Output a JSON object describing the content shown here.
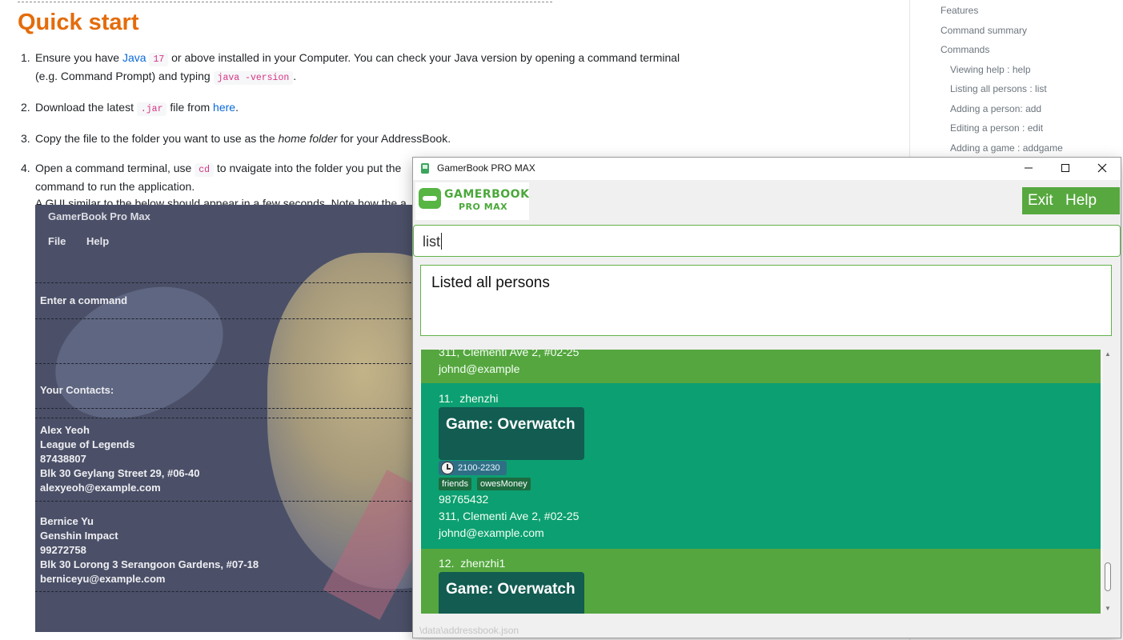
{
  "doc": {
    "title": "Quick start",
    "step1": {
      "num": "1.",
      "t1": "Ensure you have ",
      "java_link": "Java",
      "java_ver": "17",
      "t2": " or above installed in your Computer. You can check your Java version by opening a command terminal",
      "t3": "(e.g. Command Prompt) and typing ",
      "code": "java -version",
      "t4": "."
    },
    "step2": {
      "num": "2.",
      "t1": "Download the latest ",
      "code": ".jar",
      "t2": " file from ",
      "link": "here",
      "t3": "."
    },
    "step3": {
      "num": "3.",
      "t1": "Copy the file to the folder you want to use as the ",
      "ital": "home folder",
      "t2": " for your AddressBook."
    },
    "step4": {
      "num": "4.",
      "t1": "Open a command terminal, use ",
      "code": "cd",
      "t2": " to nvaigate into the folder you put the",
      "line2": "command to run the application.",
      "line3": "A GUI similar to the below should appear in a few seconds. Note how the a"
    }
  },
  "sample_gui": {
    "title": "GamerBook Pro Max",
    "menu": [
      "File",
      "Help"
    ],
    "command_label": "Enter a command",
    "contacts_label": "Your Contacts:",
    "contacts": [
      {
        "name": "Alex Yeoh",
        "game": "League of Legends",
        "phone": "87438807",
        "address": "Blk 30 Geylang Street 29, #06-40",
        "email": "alexyeoh@example.com"
      },
      {
        "name": "Bernice Yu",
        "game": "Genshin Impact",
        "phone": "99272758",
        "address": "Blk 30 Lorong 3 Serangoon Gardens, #07-18",
        "email": "berniceyu@example.com"
      }
    ]
  },
  "toc": {
    "items": [
      "Features",
      "Command summary",
      "Commands"
    ],
    "sub_items": [
      "Viewing help : help",
      "Listing all persons : list",
      "Adding a person: add",
      "Editing a person : edit",
      "Adding a game : addgame"
    ]
  },
  "app": {
    "window_title": "GamerBook PRO MAX",
    "logo_line1": "GAMERBOOK",
    "logo_line2": "PRO MAX",
    "menu": {
      "exit": "Exit",
      "help": "Help"
    },
    "command_value": "list",
    "result_text": "Listed all persons",
    "status_path": "\\data\\addressbook.json",
    "colors": {
      "card_green": "#55a63f",
      "card_teal": "#0c9f71",
      "game_box": "#125c51",
      "accent": "#61b24a"
    },
    "cards": [
      {
        "index": "",
        "name": "",
        "address": "311, Clementi Ave 2, #02-25",
        "email": "johnd@example"
      },
      {
        "index": "11.",
        "name": "zhenzhi",
        "game": "Game: Overwatch",
        "time": "2100-2230",
        "tags": [
          "friends",
          "owesMoney"
        ],
        "phone": "98765432",
        "address": "311, Clementi Ave 2, #02-25",
        "email": "johnd@example.com"
      },
      {
        "index": "12.",
        "name": "zhenzhi1",
        "game": "Game: Overwatch"
      }
    ]
  }
}
